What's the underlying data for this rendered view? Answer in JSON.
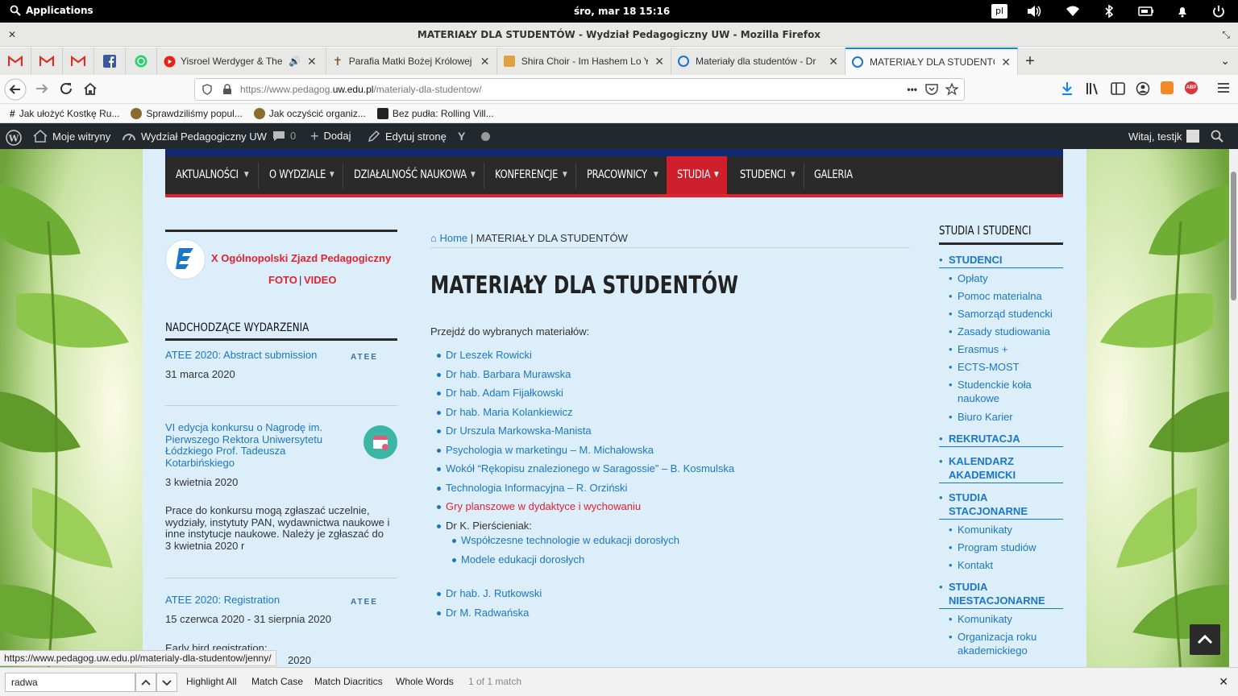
{
  "topbar": {
    "applications": "Applications",
    "date": "śro, mar 18",
    "time": "15:16",
    "lang": "pl"
  },
  "window": {
    "title": "MATERIAŁY DLA STUDENTÓW - Wydział Pedagogiczny UW - Mozilla Firefox"
  },
  "tabs": [
    {
      "title": "Yisroel Werdyger & The Sh"
    },
    {
      "title": "Parafia Matki Bożej Królowej"
    },
    {
      "title": "Shira Choir - Im Hashem Lo Yi"
    },
    {
      "title": "Materiały dla studentów - Dr"
    },
    {
      "title": "MATERIAŁY DLA STUDENTÓW"
    }
  ],
  "url": {
    "prefix": "https://www.pedagog.",
    "domain": "uw.edu.pl",
    "path": "/materialy-dla-studentow/"
  },
  "bookmarks": [
    {
      "label": "Jak ułożyć Kostkę Ru..."
    },
    {
      "label": "Sprawdziliśmy popul..."
    },
    {
      "label": "Jak oczyścić organiz..."
    },
    {
      "label": "Bez pudła: Rolling Vill..."
    }
  ],
  "wpbar": {
    "my_sites": "Moje witryny",
    "site": "Wydział Pedagogiczny UW",
    "comments": "0",
    "add": "Dodaj",
    "edit": "Edytuj stronę",
    "greeting": "Witaj, testjk"
  },
  "menu": [
    "AKTUALNOŚCI",
    "O WYDZIALE",
    "DZIAŁALNOŚĆ NAUKOWA",
    "KONFERENCJE",
    "PRACOWNICY",
    "STUDIA",
    "STUDENCI",
    "GALERIA"
  ],
  "left": {
    "congress": "X Ogólnopolski Zjazd Pedagogiczny",
    "foto": "FOTO",
    "pipe": "|",
    "video": "VIDEO",
    "events_heading": "NADCHODZĄCE WYDARZENIA",
    "ev1_title": "ATEE 2020: Abstract submission",
    "ev1_date": "31 marca 2020",
    "ev2_title": "VI edycja konkursu o Nagrodę im. Pierwszego Rektora Uniwersytetu Łódzkiego Prof. Tadeusza Kotarbińskiego",
    "ev2_date": "3 kwietnia 2020",
    "ev2_desc": "Prace do konkursu mogą zgłaszać uczelnie, wydziały, instytuty PAN, wydawnictwa naukowe i inne instytucje naukowe. Należy je zgłaszać do 3 kwietnia 2020 r",
    "ev3_title": "ATEE 2020: Registration",
    "ev3_date": "15 czerwca 2020 - 31 sierpnia 2020",
    "ev3_desc": "Early bird registration:",
    "ev3_tail": "2020",
    "atee": "ATEE"
  },
  "main": {
    "home": "Home",
    "crumb_current": "MATERIAŁY DLA STUDENTÓW",
    "title": "MATERIAŁY DLA STUDENTÓW",
    "lead": "Przejdź do wybranych materiałów:",
    "links": [
      "Dr Leszek Rowicki",
      "Dr hab. Barbara Murawska",
      "Dr hab. Adam Fijałkowski",
      "Dr hab. Maria Kolankiewicz",
      "Dr Urszula Markowska-Manista",
      "Psychologia w marketingu – M. Michałowska",
      "Wokół “Rękopisu znalezionego w Saragossie” – B. Kosmulska",
      "Technologia Informacyjna – R. Orziński",
      "Gry planszowe w dydaktyce i wychowaniu",
      "Dr K. Pierścieniak:",
      "Współczesne technologie w edukacji dorosłych",
      "Modele edukacji dorosłych",
      "Dr hab. J. Rutkowski",
      "Dr M. Radwańska"
    ]
  },
  "right": {
    "heading": "STUDIA I STUDENCI",
    "studenci": "STUDENCI",
    "studenci_items": [
      "Opłaty",
      "Pomoc materialna",
      "Samorząd studencki",
      "Zasady studiowania",
      "Erasmus +",
      "ECTS-MOST",
      "Studenckie koła naukowe",
      "Biuro Karier"
    ],
    "rekrutacja": "REKRUTACJA",
    "kalendarz": "KALENDARZ AKADEMICKI",
    "stacjonarne": "STUDIA STACJONARNE",
    "stac_items": [
      "Komunikaty",
      "Program studiów",
      "Kontakt"
    ],
    "niestacjonarne": "STUDIA NIESTACJONARNE",
    "niest_items": [
      "Komunikaty",
      "Organizacja roku akademickiego"
    ]
  },
  "status_url": "https://www.pedagog.uw.edu.pl/materialy-dla-studentow/jenny/",
  "findbar": {
    "query": "radwa",
    "highlight": "Highlight All",
    "match_case": "Match Case",
    "diacritics": "Match Diacritics",
    "whole": "Whole Words",
    "count": "1 of 1 match"
  },
  "colors": {
    "accent_red": "#e1232f",
    "link_blue": "#1b77c5",
    "menu_bg": "#2a2a2a",
    "menu_top": "#102a73"
  }
}
